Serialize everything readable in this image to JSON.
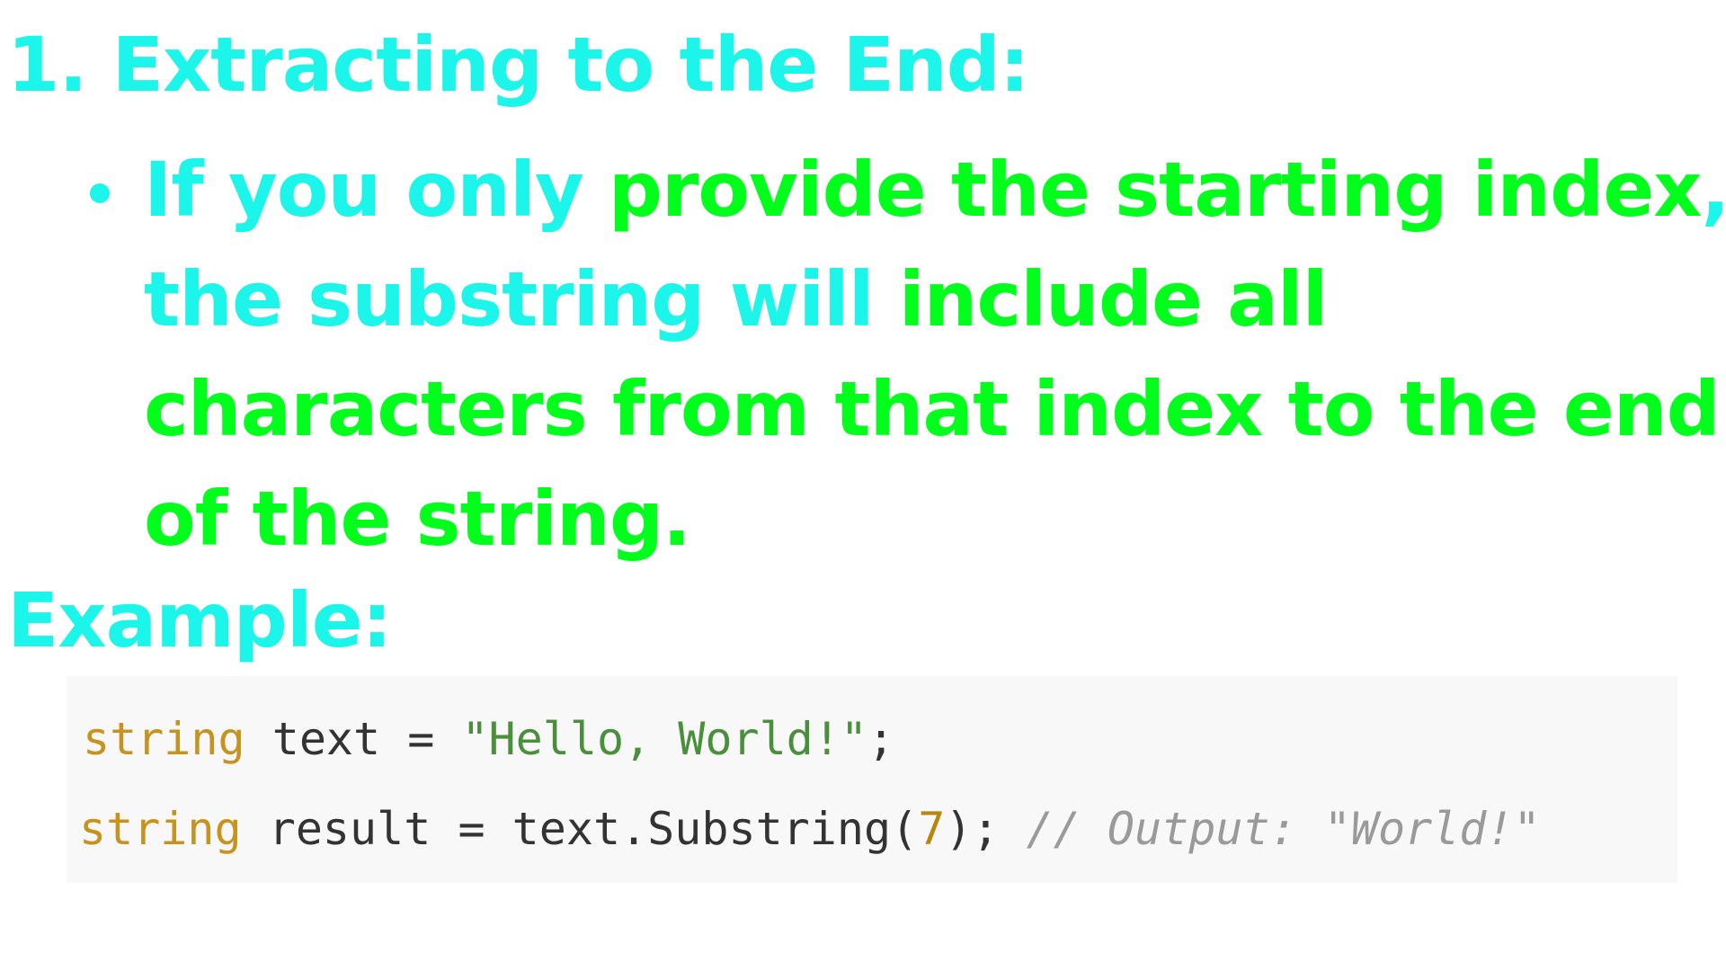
{
  "colors": {
    "cyan": "#1bf5ea",
    "green": "#00ff1a",
    "code_keyword": "#c8921e",
    "code_plain": "#333333",
    "code_string": "#4a8f3c",
    "code_number": "#b8860b",
    "code_comment": "#9a9a9a",
    "code_bg": "#f8f8f8"
  },
  "heading": {
    "text": "1. Extracting to the End:"
  },
  "bullet": {
    "part1": "If you only ",
    "part2": "provide the starting index",
    "part3": ", the substring will ",
    "part4": "include all characters from that index to the end of the string."
  },
  "example": {
    "label": "Example:"
  },
  "code": {
    "line1": {
      "keyword": "string",
      "plain": " text = ",
      "string": "\"Hello, World!\"",
      "end": ";"
    },
    "line2": {
      "keyword": "string",
      "plain": " result = text.Substring(",
      "number": "7",
      "end": "); ",
      "comment": "// Output: \"World!\""
    }
  }
}
